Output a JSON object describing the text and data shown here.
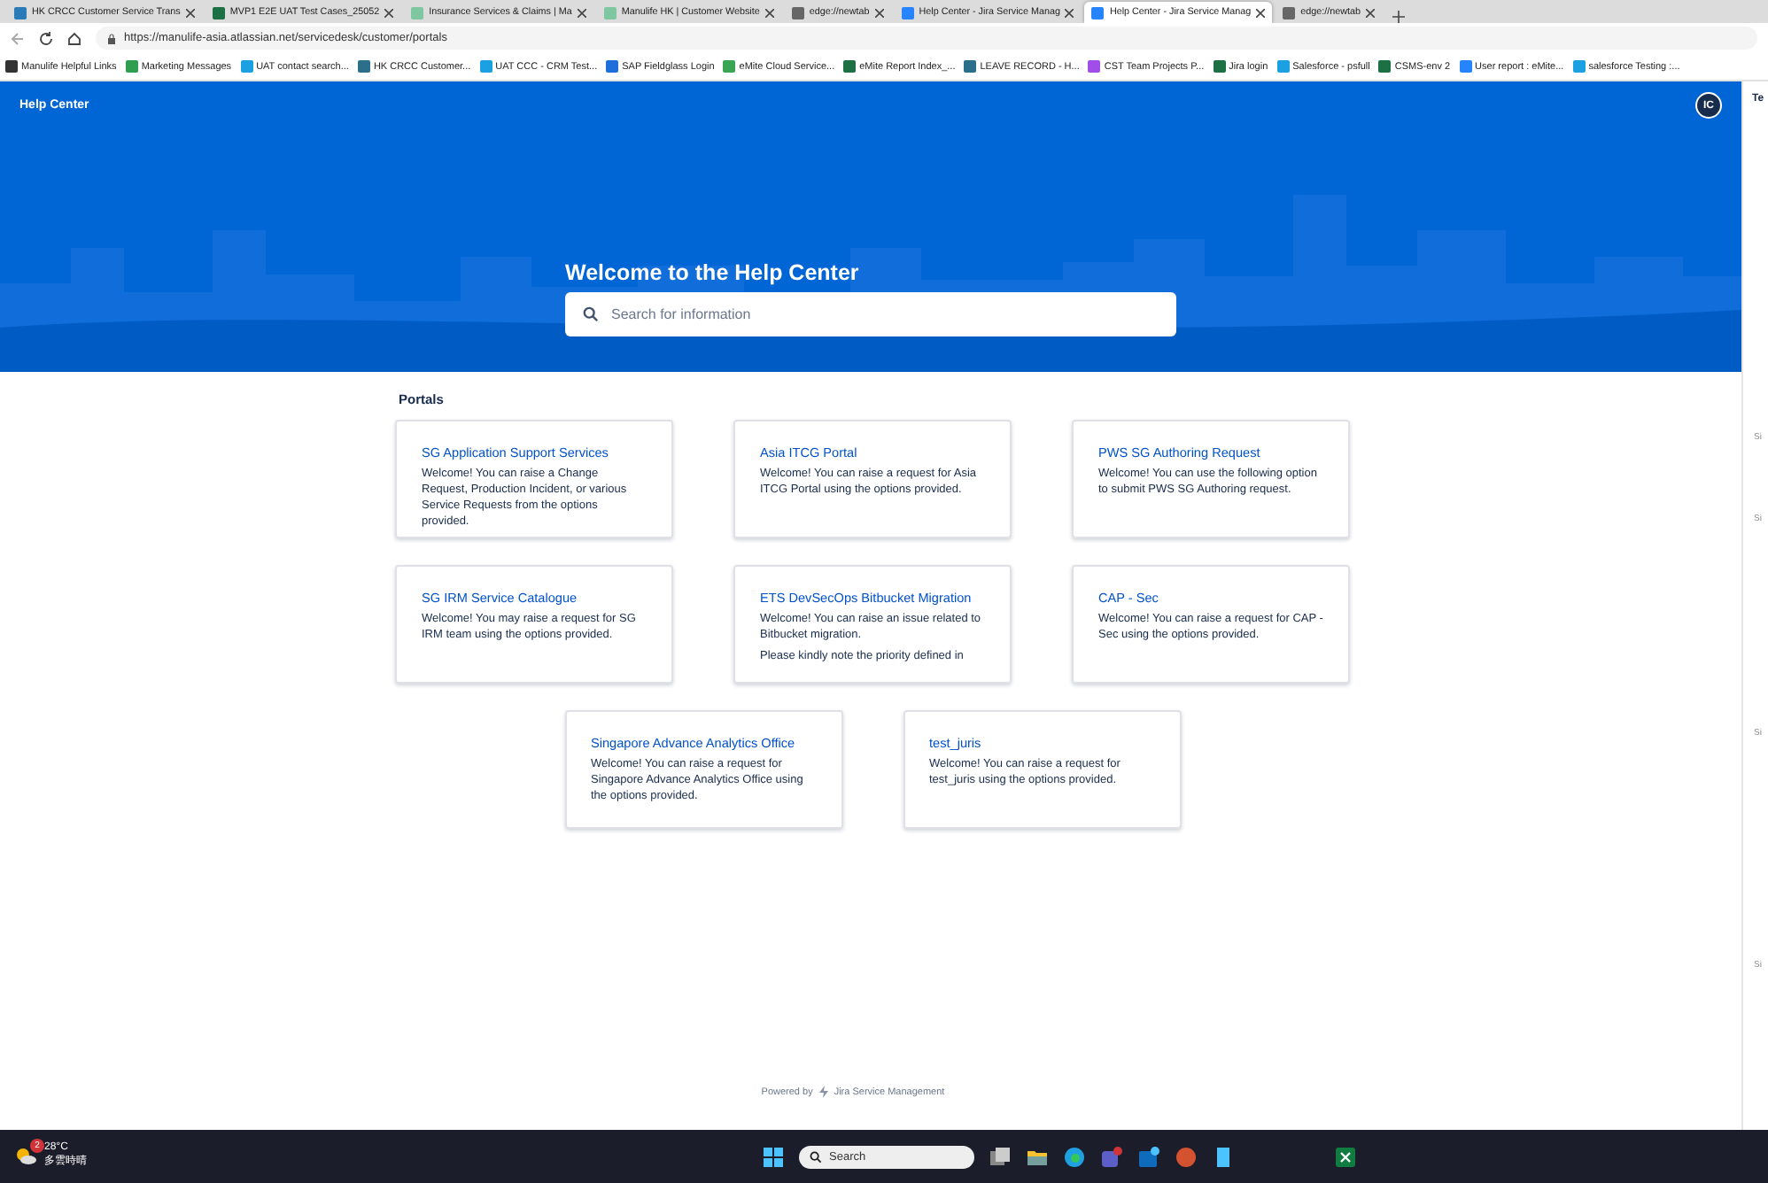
{
  "browser": {
    "tabs": [
      {
        "title": "HK CRCC Customer Service Trans",
        "color": "#2b7bb9",
        "selected": false
      },
      {
        "title": "MVP1 E2E UAT Test Cases_25052",
        "color": "#1d7044",
        "selected": false
      },
      {
        "title": "Insurance Services & Claims | Ma",
        "color": "#7fc7a0",
        "selected": false
      },
      {
        "title": "Manulife HK | Customer Website",
        "color": "#7fc7a0",
        "selected": false
      },
      {
        "title": "edge://newtab",
        "color": "#666666",
        "selected": false
      },
      {
        "title": "Help Center - Jira Service Manag",
        "color": "#2684ff",
        "selected": false
      },
      {
        "title": "Help Center - Jira Service Manag",
        "color": "#2684ff",
        "selected": true
      },
      {
        "title": "edge://newtab",
        "color": "#666666",
        "selected": false
      }
    ],
    "url": "https://manulife-asia.atlassian.net/servicedesk/customer/portals",
    "bookmarks": [
      {
        "label": "Manulife Helpful Links",
        "color": "#333333"
      },
      {
        "label": "Marketing Messages",
        "color": "#2e9e4f"
      },
      {
        "label": "UAT contact search...",
        "color": "#1ba1e2"
      },
      {
        "label": "HK CRCC Customer...",
        "color": "#2b6f8a"
      },
      {
        "label": "UAT CCC - CRM Test...",
        "color": "#1ba1e2"
      },
      {
        "label": "SAP Fieldglass Login",
        "color": "#1e6fd9"
      },
      {
        "label": "eMite Cloud Service...",
        "color": "#3aa655"
      },
      {
        "label": "eMite Report Index_...",
        "color": "#1d7044"
      },
      {
        "label": "LEAVE RECORD - H...",
        "color": "#2b6f8a"
      },
      {
        "label": "CST Team Projects P...",
        "color": "#a14ee8"
      },
      {
        "label": "Jira login",
        "color": "#1d7044"
      },
      {
        "label": "Salesforce - psfull",
        "color": "#1ba1e2"
      },
      {
        "label": "CSMS-env 2",
        "color": "#1d7044"
      },
      {
        "label": "User report : eMite...",
        "color": "#2684ff"
      },
      {
        "label": "salesforce Testing :...",
        "color": "#1ba1e2"
      }
    ]
  },
  "header": {
    "title": "Help Center",
    "avatar": "IC"
  },
  "hero": {
    "title": "Welcome to the Help Center",
    "search": {
      "placeholder": "Search for information"
    }
  },
  "portals": {
    "heading": "Portals",
    "rows": [
      [
        {
          "title": "SG Application Support Services",
          "description": [
            "Welcome! You can raise a Change Request, Production Incident, or various Service Requests from the options provided."
          ]
        },
        {
          "title": "Asia ITCG Portal",
          "description": [
            "Welcome! You can raise a request for Asia ITCG Portal using the options provided."
          ]
        },
        {
          "title": "PWS SG Authoring Request",
          "description": [
            "Welcome! You can use the following option to submit PWS SG Authoring request."
          ]
        }
      ],
      [
        {
          "title": "SG IRM Service Catalogue",
          "description": [
            "Welcome! You may raise a request for SG IRM team using the options provided."
          ]
        },
        {
          "title": "ETS DevSecOps Bitbucket Migration",
          "description": [
            "Welcome! You can raise an issue related to Bitbucket migration.",
            "Please kindly note the priority defined in"
          ]
        },
        {
          "title": "CAP - Sec",
          "description": [
            "Welcome! You can raise a request for CAP - Sec using the options provided."
          ]
        }
      ],
      [
        {
          "title": "Singapore Advance Analytics Office",
          "description": [
            "Welcome! You can raise a request for Singapore Advance Analytics Office using the options provided."
          ]
        },
        {
          "title": "test_juris",
          "description": [
            "Welcome! You can raise a request for test_juris using the options provided."
          ]
        }
      ]
    ]
  },
  "footer": {
    "powered_by": "Powered by",
    "product": "Jira Service Management"
  },
  "side_panel": {
    "title": "Te",
    "labels": [
      "Si",
      "Si",
      "Si",
      "Si"
    ]
  },
  "taskbar": {
    "temperature": "28°C",
    "weather": "多雲時晴",
    "badge": "2",
    "search": {
      "placeholder": "Search"
    }
  }
}
